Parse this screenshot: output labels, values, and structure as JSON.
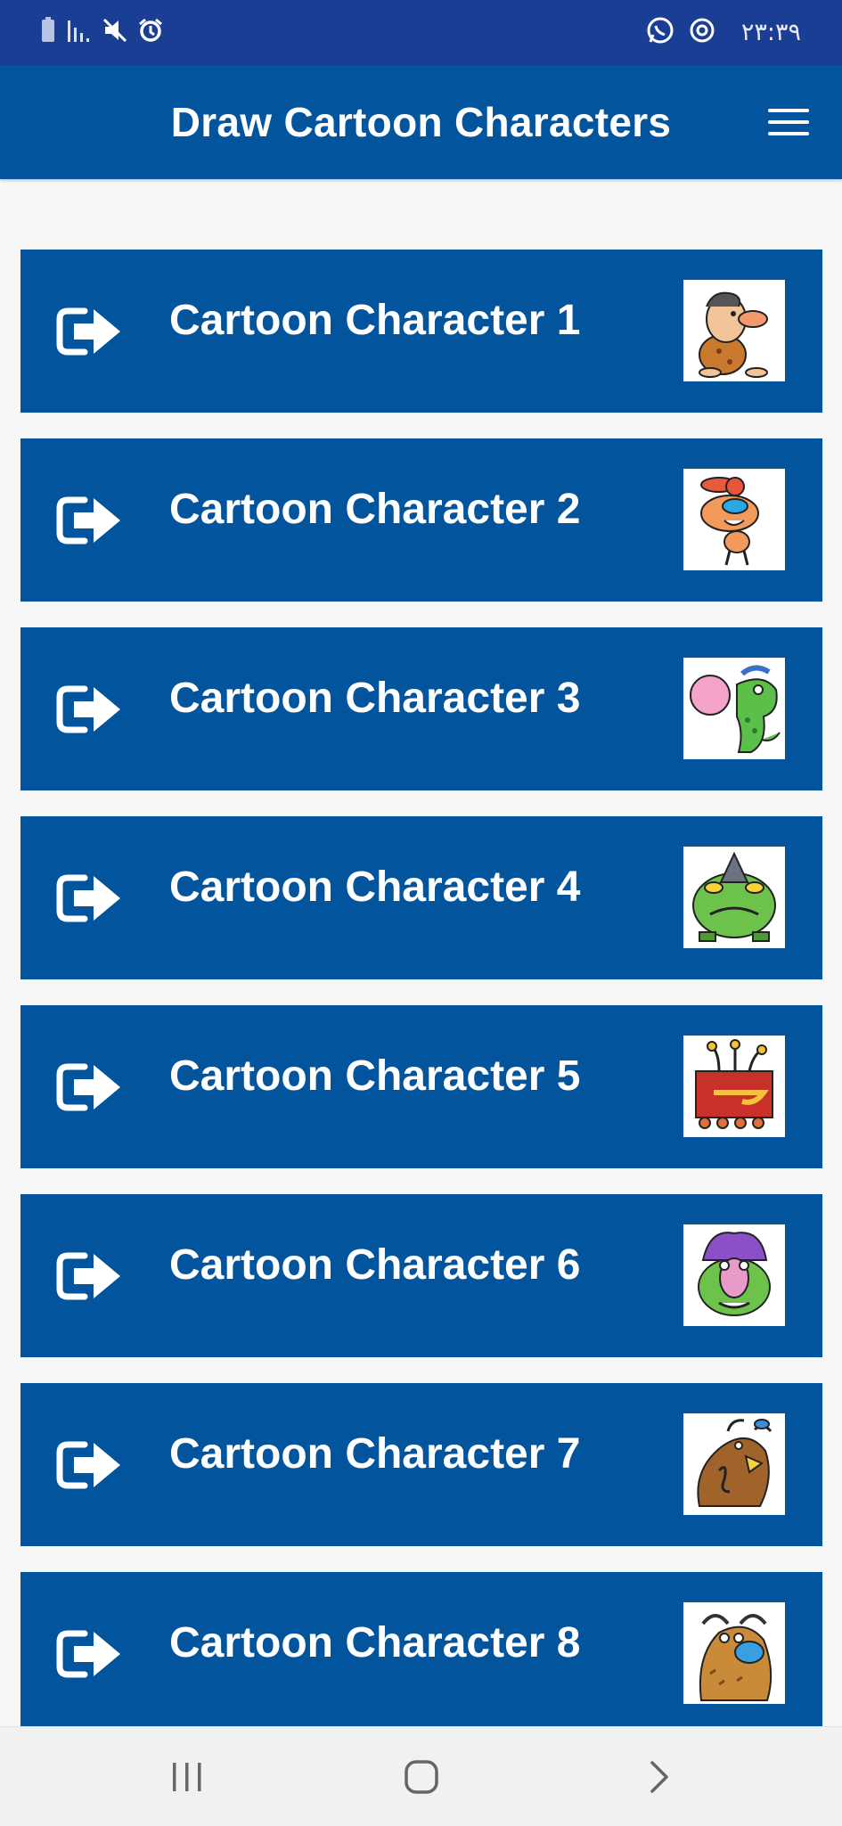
{
  "status_bar": {
    "time": "۲۳:۳۹",
    "icons_left": [
      "battery-icon",
      "signal-icon",
      "mute-icon",
      "alarm-icon"
    ],
    "icons_right": [
      "whatsapp-icon",
      "sync-icon"
    ]
  },
  "app_bar": {
    "title": "Draw Cartoon Characters",
    "menu_icon": "hamburger-menu-icon"
  },
  "colors": {
    "status_bar": "#1a3e94",
    "app_bar": "#02549d",
    "list_item": "#02549d",
    "background": "#f7f7f7",
    "text": "#ffffff"
  },
  "items": [
    {
      "label": "Cartoon Character 1",
      "icon": "exit-arrow-icon",
      "thumbnail": "caveman-character"
    },
    {
      "label": "Cartoon Character 2",
      "icon": "exit-arrow-icon",
      "thumbnail": "cap-boy-character"
    },
    {
      "label": "Cartoon Character 3",
      "icon": "exit-arrow-icon",
      "thumbnail": "green-dinosaur-bubblegum"
    },
    {
      "label": "Cartoon Character 4",
      "icon": "exit-arrow-icon",
      "thumbnail": "green-monster-character"
    },
    {
      "label": "Cartoon Character 5",
      "icon": "exit-arrow-icon",
      "thumbnail": "red-robot-monster"
    },
    {
      "label": "Cartoon Character 6",
      "icon": "exit-arrow-icon",
      "thumbnail": "purple-hair-monster"
    },
    {
      "label": "Cartoon Character 7",
      "icon": "exit-arrow-icon",
      "thumbnail": "brown-bull-monster"
    },
    {
      "label": "Cartoon Character 8",
      "icon": "exit-arrow-icon",
      "thumbnail": "horned-furry-monster"
    }
  ],
  "nav_bar": {
    "recents": "recent-apps-icon",
    "home": "home-icon",
    "back": "back-icon"
  }
}
